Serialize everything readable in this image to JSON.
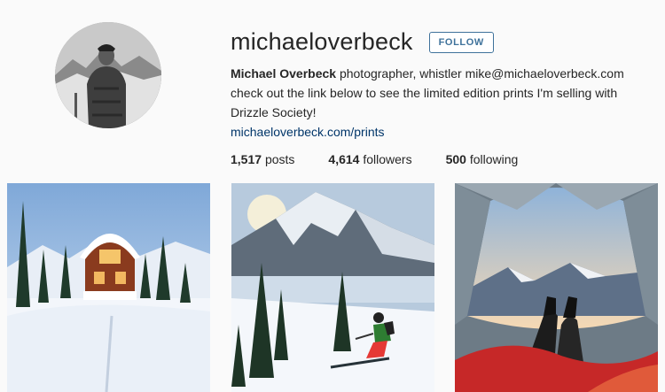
{
  "profile": {
    "username": "michaeloverbeck",
    "follow_label": "FOLLOW",
    "full_name": "Michael Overbeck",
    "bio_text": " photographer, whistler mike@michaeloverbeck.com check out the link below to see the limited edition prints I'm selling with Drizzle Society!",
    "link": "michaeloverbeck.com/prints"
  },
  "stats": {
    "posts_count": "1,517",
    "posts_label": "posts",
    "followers_count": "4,614",
    "followers_label": "followers",
    "following_count": "500",
    "following_label": "following"
  },
  "colors": {
    "accent": "#3f729b",
    "link": "#003569",
    "background": "#fafafa"
  }
}
